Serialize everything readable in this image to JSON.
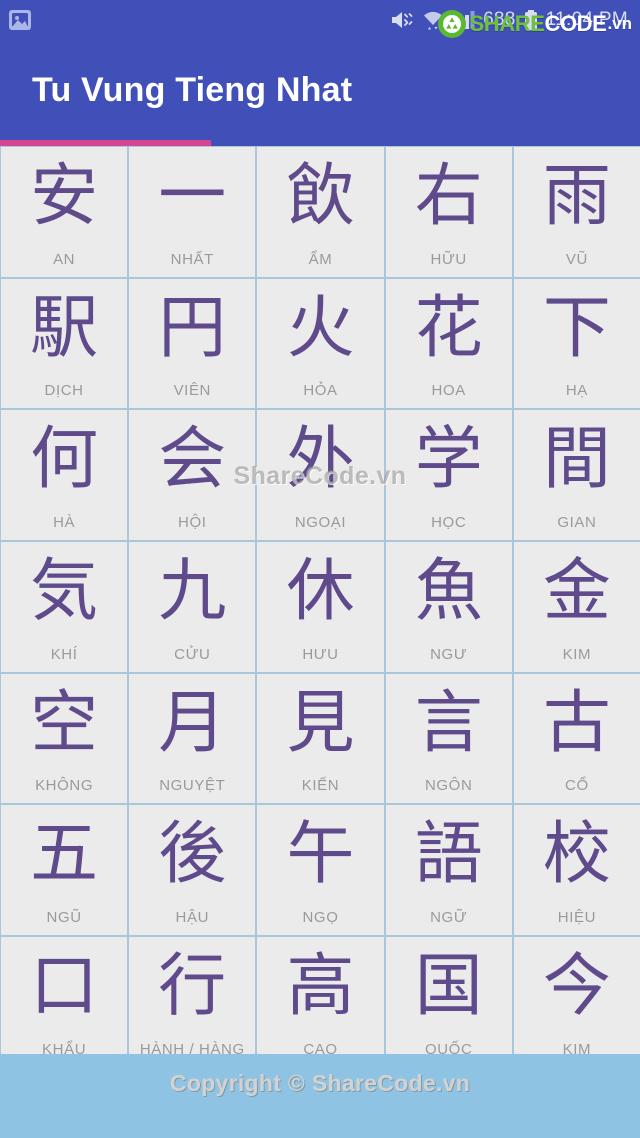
{
  "statusbar": {
    "notification_icon": "photo-icon",
    "mute_icon": "volume-mute-icon",
    "wifi_icon": "wifi-icon",
    "signal_icon": "signal-bars-icon",
    "battery_icon": "battery-icon",
    "data_value": "688",
    "clock": "11:04 PM"
  },
  "watermark_logo": {
    "icon": "sharecode-recycle-icon",
    "share": "SHARE",
    "code": "CODE",
    "tld": ".vn"
  },
  "appbar": {
    "title": "Tu Vung Tieng Nhat",
    "background": "#4050b8"
  },
  "progress": {
    "percent": 33,
    "fill_color": "#d6458f",
    "track_color": "#4050b8"
  },
  "grid": {
    "columns": 5,
    "kanji_color": "#5f4b8b",
    "cell_background": "#ecebeb",
    "gridline_color": "#a9c6da",
    "cells": [
      {
        "char": "安",
        "reading": "AN"
      },
      {
        "char": "一",
        "reading": "NHẤT"
      },
      {
        "char": "飲",
        "reading": "ẨM"
      },
      {
        "char": "右",
        "reading": "HỮU"
      },
      {
        "char": "雨",
        "reading": "VŨ"
      },
      {
        "char": "駅",
        "reading": "DỊCH"
      },
      {
        "char": "円",
        "reading": "VIÊN"
      },
      {
        "char": "火",
        "reading": "HỎA"
      },
      {
        "char": "花",
        "reading": "HOA"
      },
      {
        "char": "下",
        "reading": "HẠ"
      },
      {
        "char": "何",
        "reading": "HÀ"
      },
      {
        "char": "会",
        "reading": "HỘI"
      },
      {
        "char": "外",
        "reading": "NGOẠI"
      },
      {
        "char": "学",
        "reading": "HỌC"
      },
      {
        "char": "間",
        "reading": "GIAN"
      },
      {
        "char": "気",
        "reading": "KHÍ"
      },
      {
        "char": "九",
        "reading": "CỬU"
      },
      {
        "char": "休",
        "reading": "HƯU"
      },
      {
        "char": "魚",
        "reading": "NGƯ"
      },
      {
        "char": "金",
        "reading": "KIM"
      },
      {
        "char": "空",
        "reading": "KHÔNG"
      },
      {
        "char": "月",
        "reading": "NGUYỆT"
      },
      {
        "char": "見",
        "reading": "KIẾN"
      },
      {
        "char": "言",
        "reading": "NGÔN"
      },
      {
        "char": "古",
        "reading": "CỔ"
      },
      {
        "char": "五",
        "reading": "NGŨ"
      },
      {
        "char": "後",
        "reading": "HẬU"
      },
      {
        "char": "午",
        "reading": "NGỌ"
      },
      {
        "char": "語",
        "reading": "NGỮ"
      },
      {
        "char": "校",
        "reading": "HIỆU"
      },
      {
        "char": "口",
        "reading": "KHẨU"
      },
      {
        "char": "行",
        "reading": "HÀNH / HÀNG"
      },
      {
        "char": "高",
        "reading": "CAO"
      },
      {
        "char": "国",
        "reading": "QUỐC"
      },
      {
        "char": "今",
        "reading": "KIM"
      }
    ]
  },
  "grid_watermark": "ShareCode.vn",
  "footer": {
    "text": "Copyright © ShareCode.vn",
    "background": "#8fc3e3"
  }
}
